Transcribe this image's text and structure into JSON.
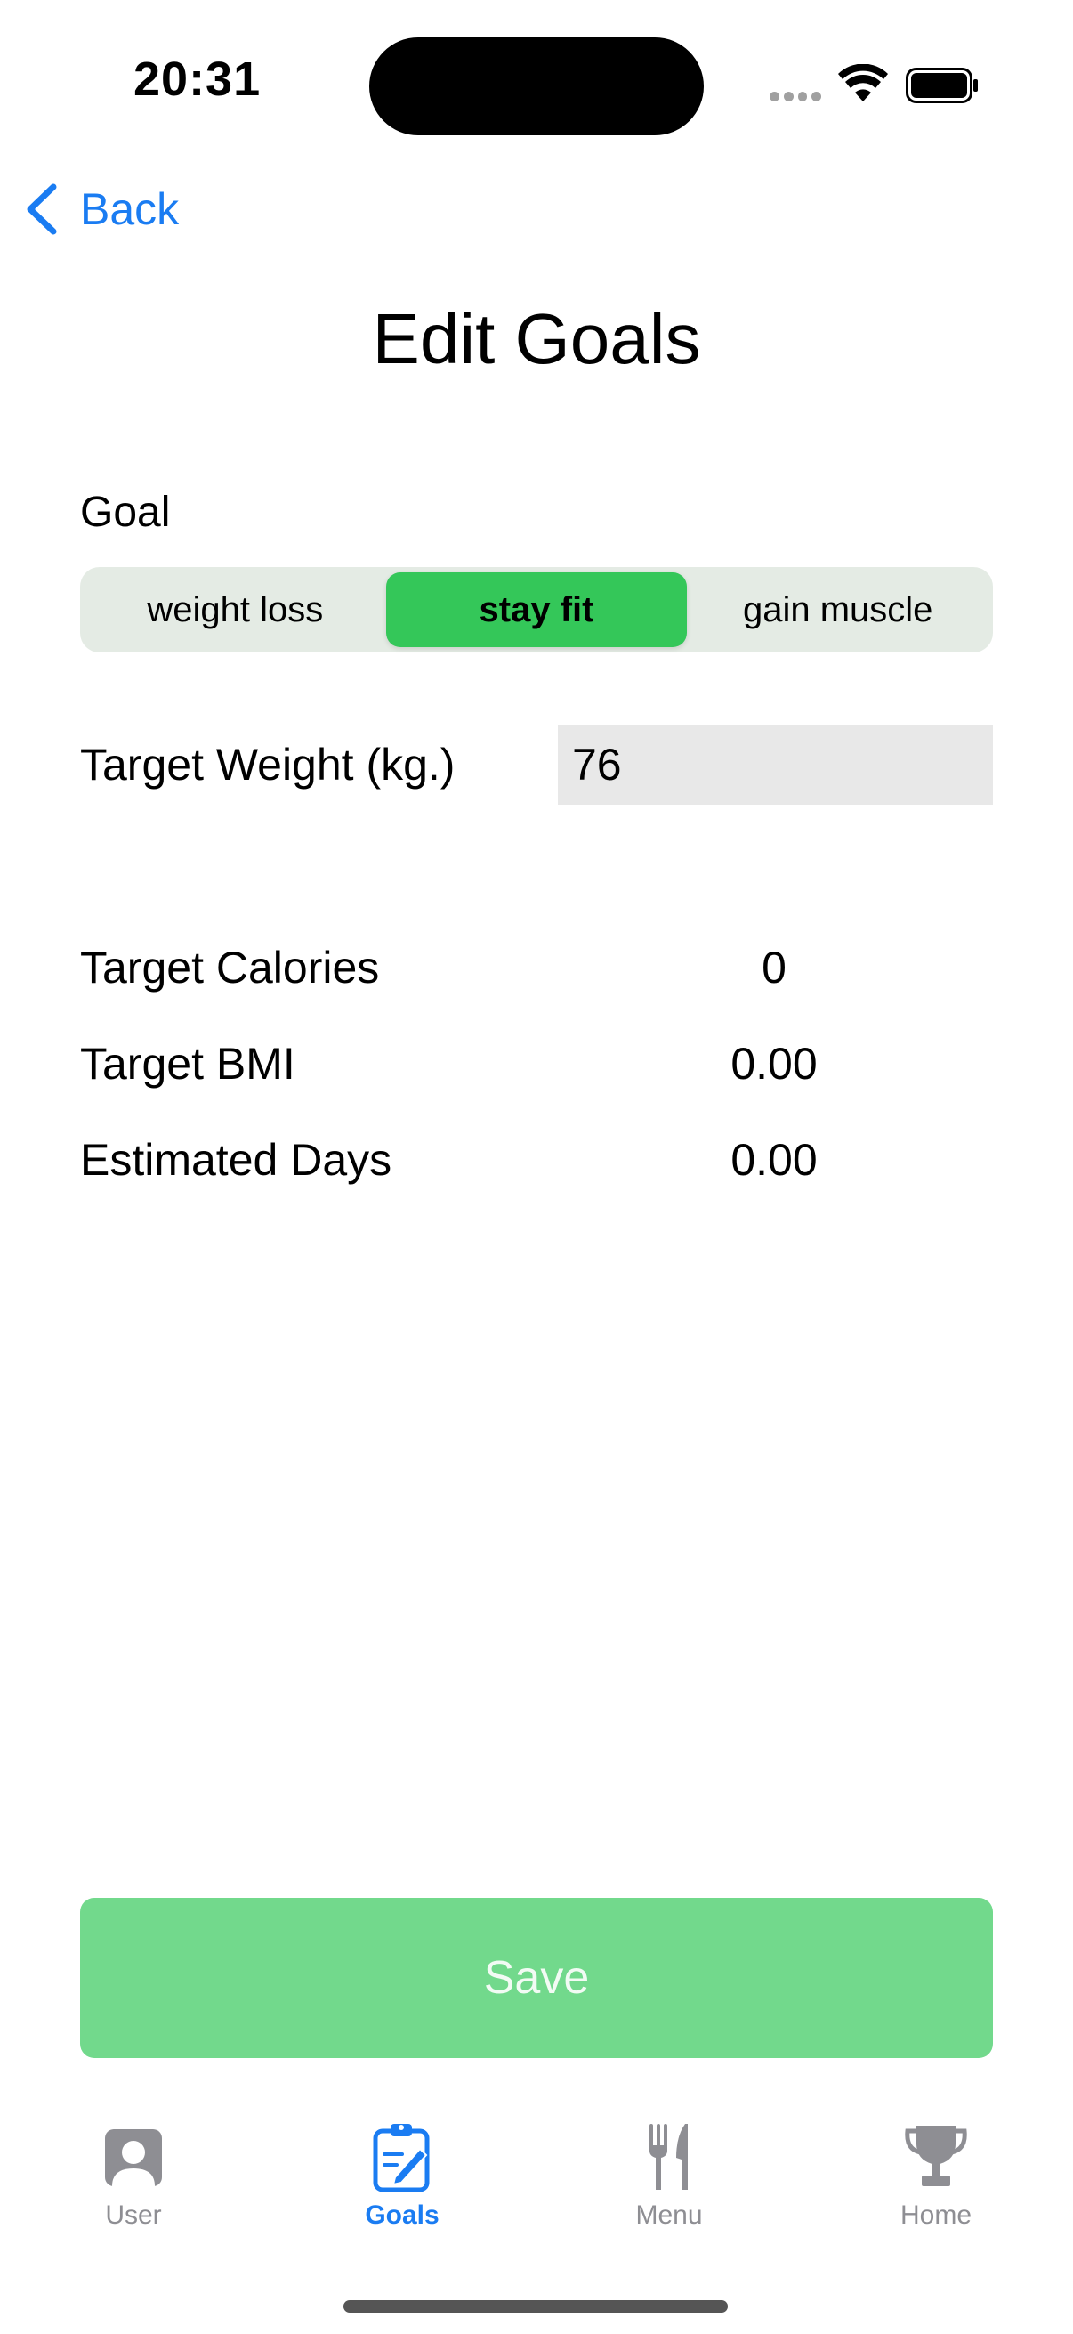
{
  "status_bar": {
    "time": "20:31"
  },
  "nav": {
    "back_label": "Back"
  },
  "title": "Edit Goals",
  "goal": {
    "label": "Goal",
    "options": [
      "weight loss",
      "stay fit",
      "gain muscle"
    ],
    "selected": "stay fit"
  },
  "target_weight": {
    "label": "Target Weight (kg.)",
    "value": "76"
  },
  "stats": [
    {
      "label": "Target Calories",
      "value": "0"
    },
    {
      "label": "Target BMI",
      "value": "0.00"
    },
    {
      "label": "Estimated Days",
      "value": "0.00"
    }
  ],
  "save_label": "Save",
  "tabs": [
    {
      "label": "User",
      "icon": "person-icon",
      "active": false
    },
    {
      "label": "Goals",
      "icon": "clipboard-edit-icon",
      "active": true
    },
    {
      "label": "Menu",
      "icon": "fork-knife-icon",
      "active": false
    },
    {
      "label": "Home",
      "icon": "trophy-icon",
      "active": false
    }
  ],
  "colors": {
    "accent_blue": "#1a7cf2",
    "segment_selected": "#34c759",
    "save_button": "#72d98c",
    "inactive_tab": "#8e8e93"
  }
}
